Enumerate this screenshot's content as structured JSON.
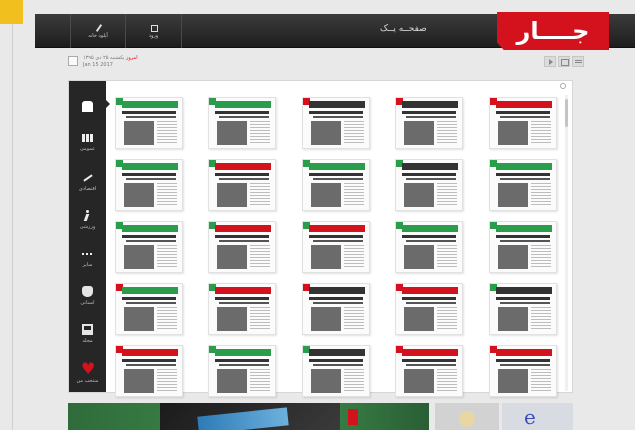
{
  "header": {
    "logo_text": "جــــار",
    "page_label": "صفحــه یــک",
    "buttons": [
      {
        "label": "آپلود خانه",
        "icon": "pencil-icon"
      },
      {
        "label": "ورود",
        "icon": "login-icon"
      }
    ]
  },
  "subbar": {
    "date_highlight": "امروز",
    "date_line1": "یکشنبه ۲۵ دی ۱۳۹۵",
    "date_line2": "Jan 15 2017"
  },
  "search": {
    "placeholder": ""
  },
  "sidebar": {
    "items": [
      {
        "label": "",
        "icon": "home-icon"
      },
      {
        "label": "عمومی",
        "icon": "people-icon"
      },
      {
        "label": "اقتصادی",
        "icon": "chart-icon"
      },
      {
        "label": "ورزشی",
        "icon": "runner-icon"
      },
      {
        "label": "سایر",
        "icon": "more-icon"
      },
      {
        "label": "استانی",
        "icon": "hand-icon"
      },
      {
        "label": "مجله",
        "icon": "magazine-icon"
      },
      {
        "label": "منتخب من",
        "icon": "heart-icon"
      }
    ]
  },
  "colors": {
    "brand_red": "#d4121e",
    "accent_green": "#2a9d4a",
    "sidebar_bg": "#262626"
  },
  "newspapers": [
    {
      "mast_color": "#2a9d4a",
      "badge": "#2a9d4a"
    },
    {
      "mast_color": "#2a9d4a",
      "badge": "#2a9d4a"
    },
    {
      "mast_color": "#333333",
      "badge": "#d4121e"
    },
    {
      "mast_color": "#333333",
      "badge": "#d4121e"
    },
    {
      "mast_color": "#d4121e",
      "badge": "#d4121e"
    },
    {
      "mast_color": "#2a9d4a",
      "badge": "#2a9d4a"
    },
    {
      "mast_color": "#d4121e",
      "badge": "#2a9d4a"
    },
    {
      "mast_color": "#2a9d4a",
      "badge": "#2a9d4a"
    },
    {
      "mast_color": "#333333",
      "badge": "#2a9d4a"
    },
    {
      "mast_color": "#2a9d4a",
      "badge": "#2a9d4a"
    },
    {
      "mast_color": "#2a9d4a",
      "badge": "#2a9d4a"
    },
    {
      "mast_color": "#d4121e",
      "badge": "#2a9d4a"
    },
    {
      "mast_color": "#d4121e",
      "badge": "#2a9d4a"
    },
    {
      "mast_color": "#2a9d4a",
      "badge": "#2a9d4a"
    },
    {
      "mast_color": "#2a9d4a",
      "badge": "#2a9d4a"
    },
    {
      "mast_color": "#2a9d4a",
      "badge": "#d4121e"
    },
    {
      "mast_color": "#d4121e",
      "badge": "#2a9d4a"
    },
    {
      "mast_color": "#333333",
      "badge": "#d4121e"
    },
    {
      "mast_color": "#d4121e",
      "badge": "#d4121e"
    },
    {
      "mast_color": "#333333",
      "badge": "#2a9d4a"
    },
    {
      "mast_color": "#d4121e",
      "badge": "#d4121e"
    },
    {
      "mast_color": "#2a9d4a",
      "badge": "#2a9d4a"
    },
    {
      "mast_color": "#333333",
      "badge": "#2a9d4a"
    },
    {
      "mast_color": "#d4121e",
      "badge": "#d4121e"
    },
    {
      "mast_color": "#d4121e",
      "badge": "#d4121e"
    }
  ]
}
